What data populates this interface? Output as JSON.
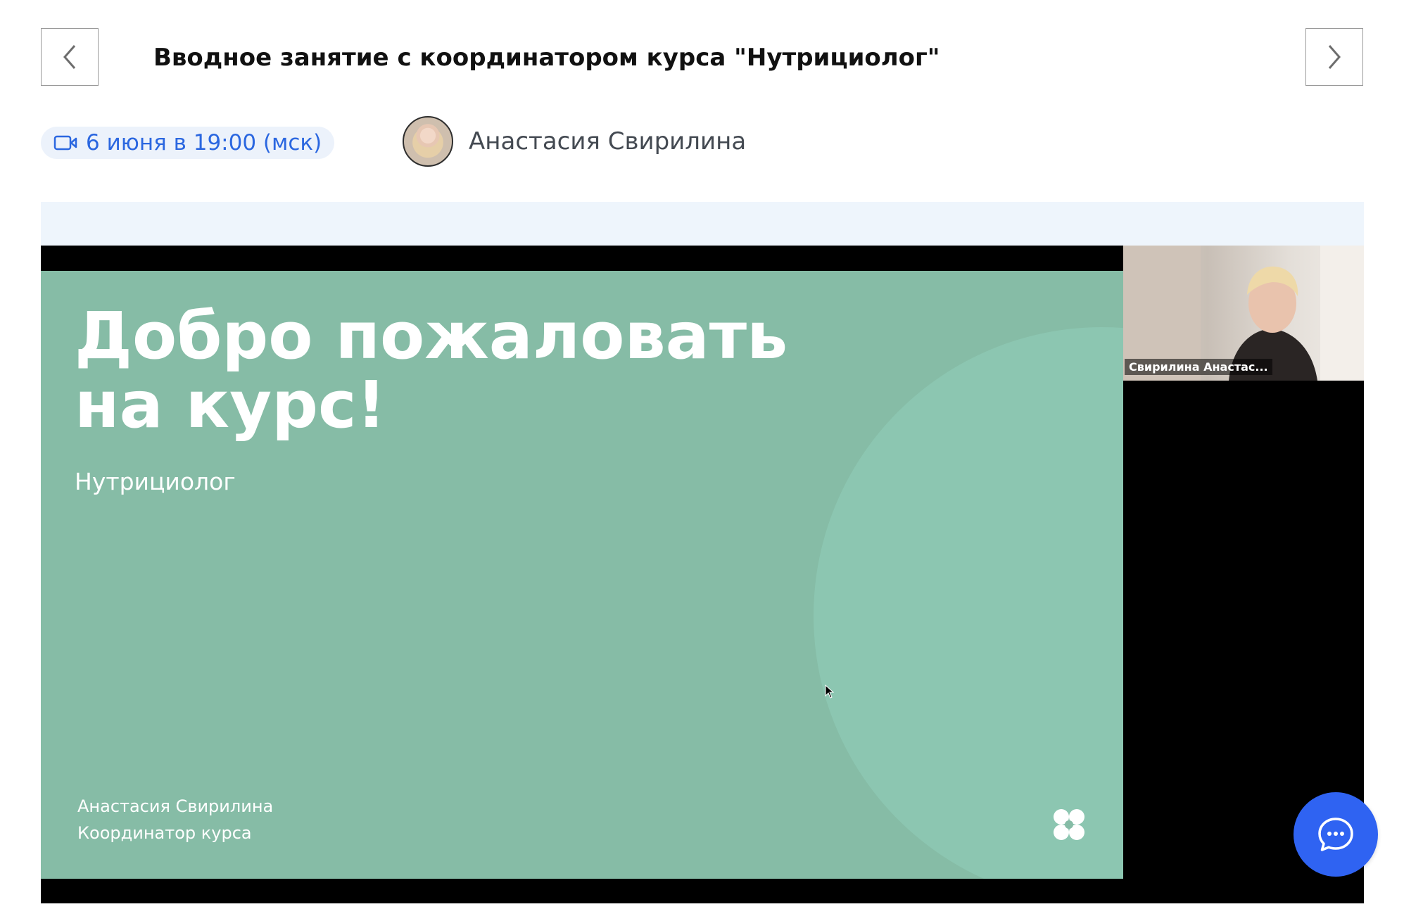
{
  "lesson": {
    "title": "Вводное занятие с координатором курса \"Нутрициолог\"",
    "date_label": "6 июня в 19:00 (мск)",
    "speaker_name": "Анастасия Свирилина"
  },
  "slide": {
    "title_line1": "Добро пожаловать",
    "title_line2": "на курс!",
    "subtitle": "Нутрициолог",
    "author_name": "Анастасия Свирилина",
    "author_role": "Координатор курса"
  },
  "webcam": {
    "label": "Свирилина Анастас..."
  },
  "icons": {
    "prev": "chevron-left-icon",
    "next": "chevron-right-icon",
    "video": "video-camera-icon",
    "chat": "chat-bubble-icon",
    "logo": "four-petal-logo-icon"
  },
  "colors": {
    "accent": "#2f63f2",
    "date_text": "#2b67e0",
    "slide_bg": "#86bca6"
  }
}
